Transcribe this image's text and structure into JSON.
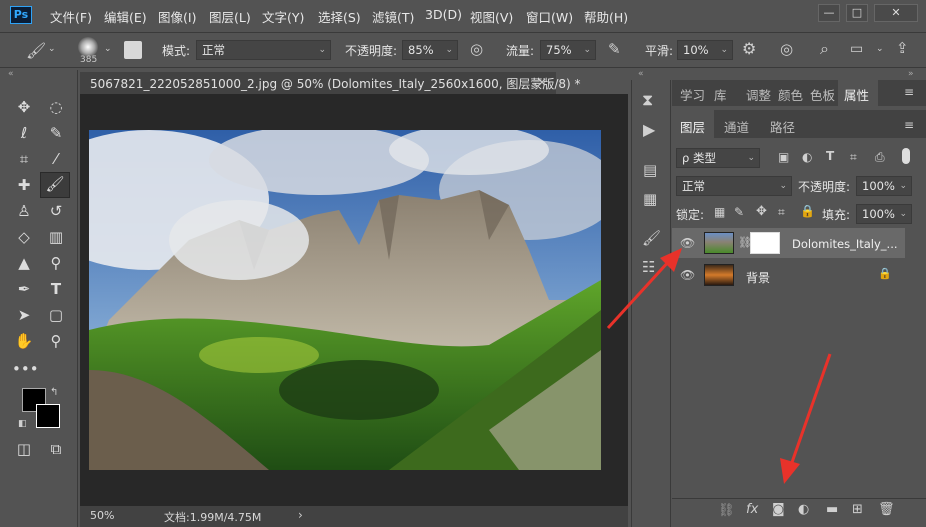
{
  "app": {
    "logo": "Ps"
  },
  "menu": [
    "文件(F)",
    "编辑(E)",
    "图像(I)",
    "图层(L)",
    "文字(Y)",
    "选择(S)",
    "滤镜(T)",
    "3D(D)",
    "视图(V)",
    "窗口(W)",
    "帮助(H)"
  ],
  "options": {
    "brush_size": "385",
    "mode_label": "模式:",
    "mode_value": "正常",
    "opacity_label": "不透明度:",
    "opacity_value": "85%",
    "flow_label": "流量:",
    "flow_value": "75%",
    "smooth_label": "平滑:",
    "smooth_value": "10%"
  },
  "document": {
    "tab_title": "5067821_222052851000_2.jpg @ 50% (Dolomites_Italy_2560x1600, 图层蒙版/8) *",
    "close": "×",
    "zoom": "50%",
    "doc_size": "文档:1.99M/4.75M",
    "status_arrow": "›"
  },
  "panel": {
    "top_tabs": [
      "学习",
      "库",
      "调整",
      "颜色",
      "色板",
      "属性"
    ],
    "sub_tabs": [
      "图层",
      "通道",
      "路径"
    ],
    "filter_kind": "ρ 类型",
    "blend_mode": "正常",
    "opacity_label": "不透明度:",
    "opacity_value": "100%",
    "lock_label": "锁定:",
    "fill_label": "填充:",
    "fill_value": "100%",
    "layers": [
      {
        "name": "Dolomites_Italy_...",
        "selected": true
      },
      {
        "name": "背景",
        "selected": false
      }
    ],
    "bottom_icons": [
      "link-icon",
      "fx-icon",
      "mask-icon",
      "adjustment-icon",
      "folder-icon",
      "new-layer-icon",
      "trash-icon"
    ]
  },
  "colors": {
    "accent_arrow": "#e8322a",
    "ui_bg": "#535353",
    "doc_bg": "#282828"
  }
}
